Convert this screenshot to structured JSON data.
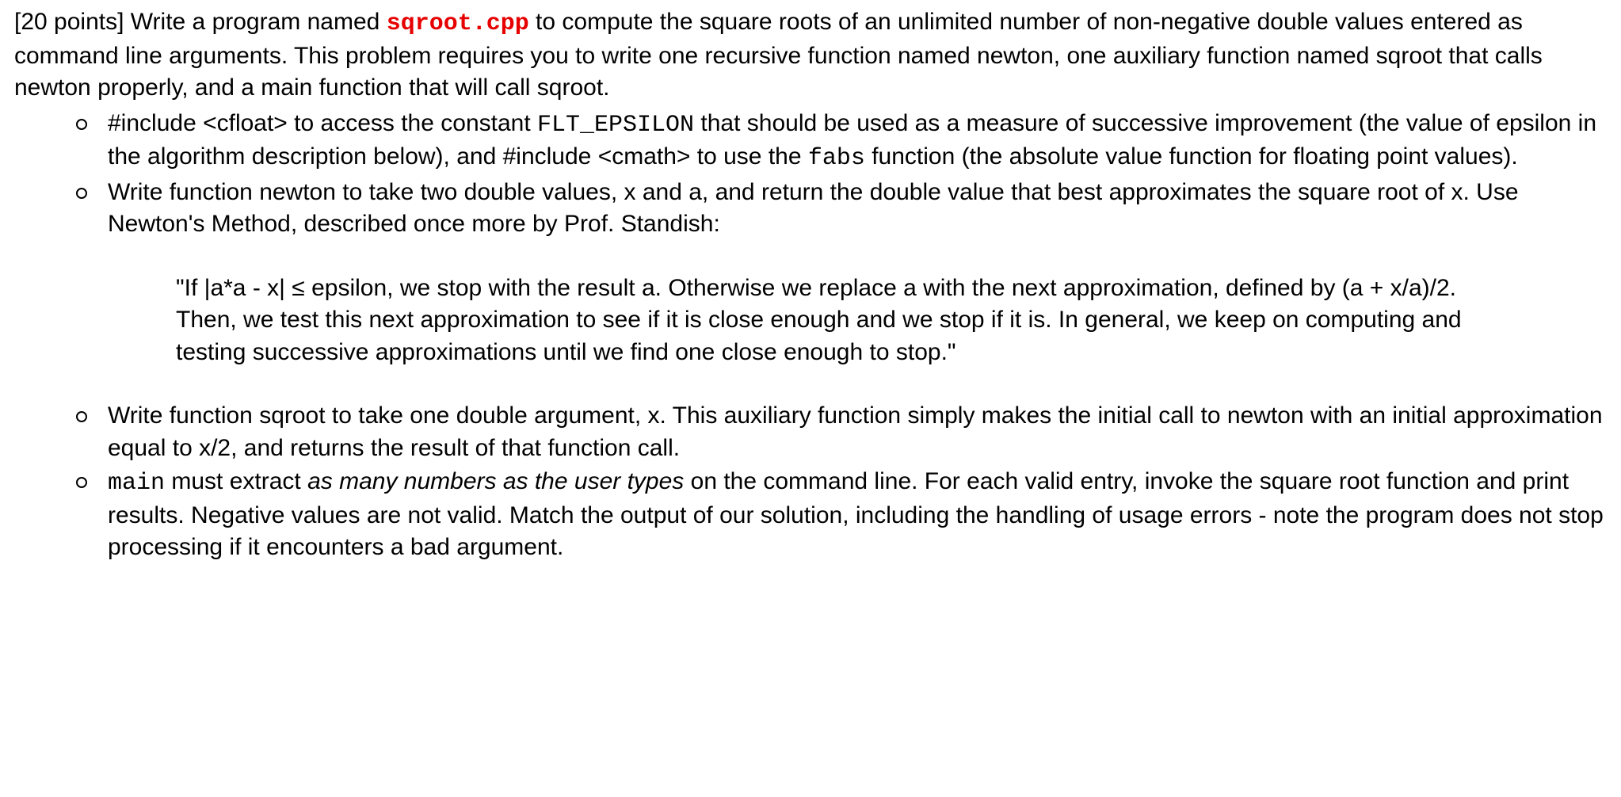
{
  "intro": {
    "points": "[20 points]",
    "text1": " Write a program named ",
    "filename": "sqroot.cpp",
    "text2": " to compute the square roots of an unlimited number of non-negative double values entered as command line arguments. This problem requires you to write one recursive function named newton, one auxiliary function named sqroot that calls newton properly, and a main function that will call sqroot."
  },
  "bullets": {
    "b1": {
      "p1": "#include <cfloat> to access the constant ",
      "code1": "FLT_EPSILON",
      "p2": " that should be used as a measure of successive improvement (the value of epsilon in the algorithm description below), and #include <cmath> to use the ",
      "code2": "fabs",
      "p3": " function (the absolute value function for floating point values)."
    },
    "b2": {
      "p1": "Write function newton to take two double values, x and a, and return the double value that best approximates the square root of x. Use Newton's Method, described once more by Prof. Standish:",
      "quote": "\"If |a*a - x| ≤ epsilon, we stop with the result a. Otherwise we replace a with the next approximation, defined by (a + x/a)/2. Then, we test this next approximation to see if it is close enough and we stop if it is. In general, we keep on computing and testing successive approximations until we find one close enough to stop.\""
    },
    "b3": {
      "p1": "Write function sqroot to take one double argument, x. This auxiliary function simply makes the initial call to newton with an initial approximation equal to x/2, and returns the result of that function call."
    },
    "b4": {
      "code1": "main",
      "p1": " must extract ",
      "italic": "as many numbers as the user types",
      "p2": " on the command line. For each valid entry, invoke the square root function and print results. Negative values are not valid. Match the output of our solution, including the handling of usage errors - note the program does not stop processing if it encounters a bad argument."
    }
  }
}
